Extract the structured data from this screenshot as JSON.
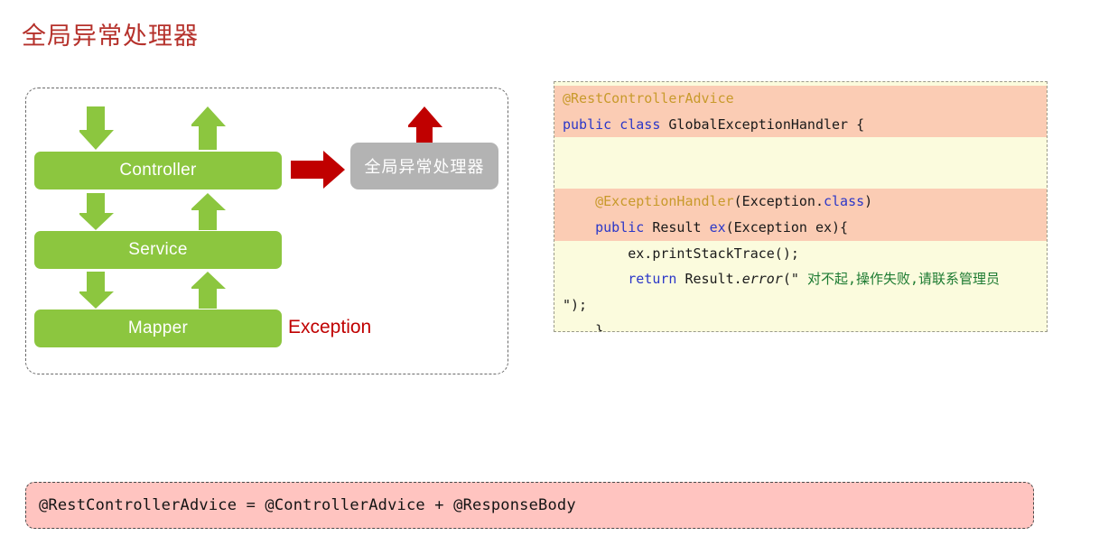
{
  "page": {
    "title": "全局异常处理器",
    "title_color": "#b5312b",
    "background": "#ffffff"
  },
  "diagram": {
    "name": "layered-architecture-diagram",
    "border_style": "dashed",
    "layers": [
      {
        "label": "Controller",
        "color": "#8cc63f"
      },
      {
        "label": "Service",
        "color": "#8cc63f"
      },
      {
        "label": "Mapper",
        "color": "#8cc63f"
      }
    ],
    "handler_box": {
      "label": "全局异常处理器",
      "color": "#b3b3b3",
      "text_color": "#ffffff"
    },
    "exception_label": {
      "text": "Exception",
      "color": "#c00000"
    },
    "arrows": {
      "down_color": "#8cc63f",
      "up_color": "#8cc63f",
      "red_color": "#c00000"
    }
  },
  "code_panel": {
    "background": "#fbfbdd",
    "highlight": "#fbccb4",
    "lines": [
      {
        "highlight": true,
        "tokens": [
          {
            "text": "@RestControllerAdvice",
            "style": "ann"
          }
        ]
      },
      {
        "highlight": true,
        "tokens": [
          {
            "text": "public",
            "style": "kw"
          },
          {
            "text": " ",
            "style": "plain"
          },
          {
            "text": "class",
            "style": "kw"
          },
          {
            "text": " GlobalExceptionHandler {",
            "style": "plain"
          }
        ]
      },
      {
        "highlight": false,
        "tokens": [
          {
            "text": "",
            "style": "plain"
          }
        ]
      },
      {
        "highlight": false,
        "tokens": [
          {
            "text": "",
            "style": "plain"
          }
        ]
      },
      {
        "highlight": true,
        "tokens": [
          {
            "text": "    ",
            "style": "plain"
          },
          {
            "text": "@ExceptionHandler",
            "style": "ann"
          },
          {
            "text": "(Exception.",
            "style": "plain"
          },
          {
            "text": "class",
            "style": "kw"
          },
          {
            "text": ")",
            "style": "plain"
          }
        ]
      },
      {
        "highlight": true,
        "tokens": [
          {
            "text": "    ",
            "style": "plain"
          },
          {
            "text": "public",
            "style": "kw"
          },
          {
            "text": " Result ",
            "style": "plain"
          },
          {
            "text": "ex",
            "style": "kw"
          },
          {
            "text": "(Exception ex){",
            "style": "plain"
          }
        ]
      },
      {
        "highlight": false,
        "tokens": [
          {
            "text": "        ex.printStackTrace();",
            "style": "plain"
          }
        ]
      },
      {
        "highlight": false,
        "tokens": [
          {
            "text": "        ",
            "style": "plain"
          },
          {
            "text": "return",
            "style": "kw"
          },
          {
            "text": " Result.",
            "style": "plain"
          },
          {
            "text": "error",
            "style": "ital"
          },
          {
            "text": "(\" ",
            "style": "plain"
          },
          {
            "text": "对不起,操作失败,请联系管理员",
            "style": "str"
          }
        ]
      },
      {
        "highlight": false,
        "tokens": [
          {
            "text": "\");",
            "style": "plain"
          }
        ]
      },
      {
        "highlight": false,
        "tokens": [
          {
            "text": "    }",
            "style": "plain"
          }
        ]
      },
      {
        "highlight": false,
        "tokens": [
          {
            "text": "}",
            "style": "plain"
          }
        ]
      }
    ]
  },
  "bottom_banner": {
    "text": "@RestControllerAdvice = @ControllerAdvice + @ResponseBody",
    "background": "#ffc4c0",
    "text_color": "#141414"
  }
}
